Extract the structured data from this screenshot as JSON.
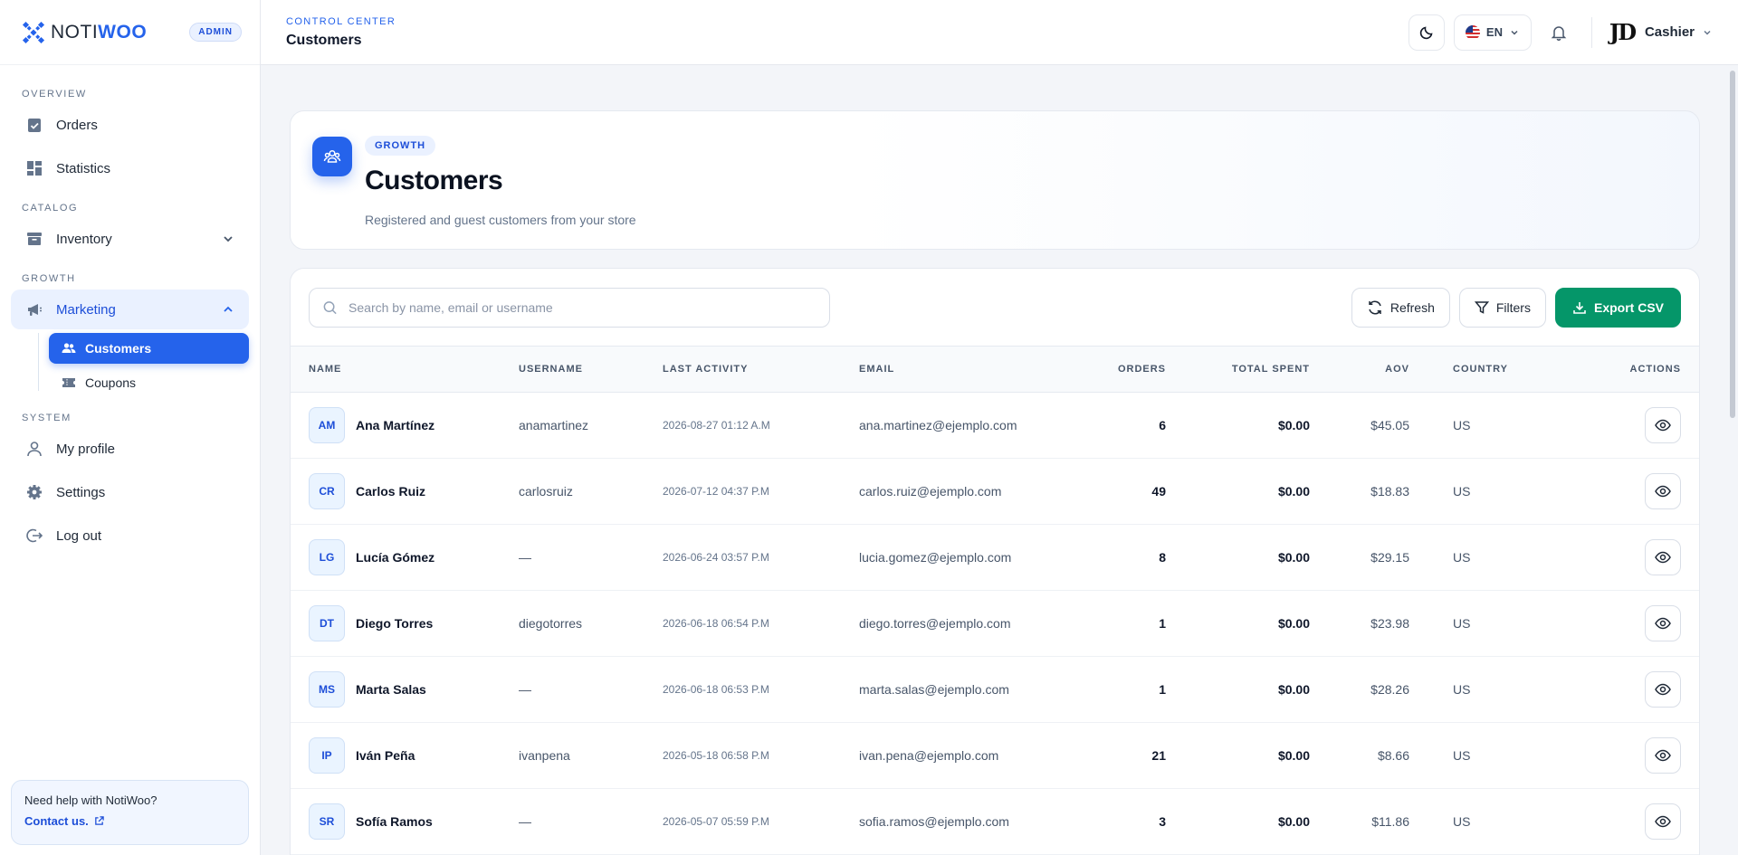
{
  "brand": {
    "logo_part1": "NOTI",
    "logo_part2": "WOO",
    "badge": "ADMIN"
  },
  "sidebar": {
    "sections": [
      {
        "label": "OVERVIEW"
      },
      {
        "label": "CATALOG"
      },
      {
        "label": "GROWTH"
      },
      {
        "label": "SYSTEM"
      }
    ],
    "items": {
      "orders": "Orders",
      "statistics": "Statistics",
      "inventory": "Inventory",
      "marketing": "Marketing",
      "customers": "Customers",
      "coupons": "Coupons",
      "profile": "My profile",
      "settings": "Settings",
      "logout": "Log out"
    },
    "help": {
      "text": "Need help with NotiWoo?",
      "link": "Contact us."
    }
  },
  "topbar": {
    "crumb": "CONTROL CENTER",
    "title": "Customers",
    "language": "EN",
    "user_name": "Cashier",
    "avatar_initials": "JD"
  },
  "hero": {
    "pill": "GROWTH",
    "title": "Customers",
    "subtitle": "Registered and guest customers from your store"
  },
  "toolbar": {
    "search_placeholder": "Search by name, email or username",
    "refresh": "Refresh",
    "filters": "Filters",
    "export": "Export CSV"
  },
  "table": {
    "columns": {
      "name": "NAME",
      "username": "USERNAME",
      "last_activity": "LAST ACTIVITY",
      "email": "EMAIL",
      "orders": "ORDERS",
      "total_spent": "TOTAL SPENT",
      "aov": "AOV",
      "country": "COUNTRY",
      "actions": "ACTIONS"
    },
    "rows": [
      {
        "initials": "AM",
        "name": "Ana Martínez",
        "username": "anamartinez",
        "last_activity": "2026-08-27 01:12 A.M",
        "email": "ana.martinez@ejemplo.com",
        "orders": "6",
        "total_spent": "$0.00",
        "aov": "$45.05",
        "country": "US"
      },
      {
        "initials": "CR",
        "name": "Carlos Ruiz",
        "username": "carlosruiz",
        "last_activity": "2026-07-12 04:37 P.M",
        "email": "carlos.ruiz@ejemplo.com",
        "orders": "49",
        "total_spent": "$0.00",
        "aov": "$18.83",
        "country": "US"
      },
      {
        "initials": "LG",
        "name": "Lucía Gómez",
        "username": "—",
        "last_activity": "2026-06-24 03:57 P.M",
        "email": "lucia.gomez@ejemplo.com",
        "orders": "8",
        "total_spent": "$0.00",
        "aov": "$29.15",
        "country": "US"
      },
      {
        "initials": "DT",
        "name": "Diego Torres",
        "username": "diegotorres",
        "last_activity": "2026-06-18 06:54 P.M",
        "email": "diego.torres@ejemplo.com",
        "orders": "1",
        "total_spent": "$0.00",
        "aov": "$23.98",
        "country": "US"
      },
      {
        "initials": "MS",
        "name": "Marta Salas",
        "username": "—",
        "last_activity": "2026-06-18 06:53 P.M",
        "email": "marta.salas@ejemplo.com",
        "orders": "1",
        "total_spent": "$0.00",
        "aov": "$28.26",
        "country": "US"
      },
      {
        "initials": "IP",
        "name": "Iván Peña",
        "username": "ivanpena",
        "last_activity": "2026-05-18 06:58 P.M",
        "email": "ivan.pena@ejemplo.com",
        "orders": "21",
        "total_spent": "$0.00",
        "aov": "$8.66",
        "country": "US"
      },
      {
        "initials": "SR",
        "name": "Sofía Ramos",
        "username": "—",
        "last_activity": "2026-05-07 05:59 P.M",
        "email": "sofia.ramos@ejemplo.com",
        "orders": "3",
        "total_spent": "$0.00",
        "aov": "$11.86",
        "country": "US"
      }
    ]
  },
  "colors": {
    "accent": "#2563eb",
    "export": "#059669"
  }
}
